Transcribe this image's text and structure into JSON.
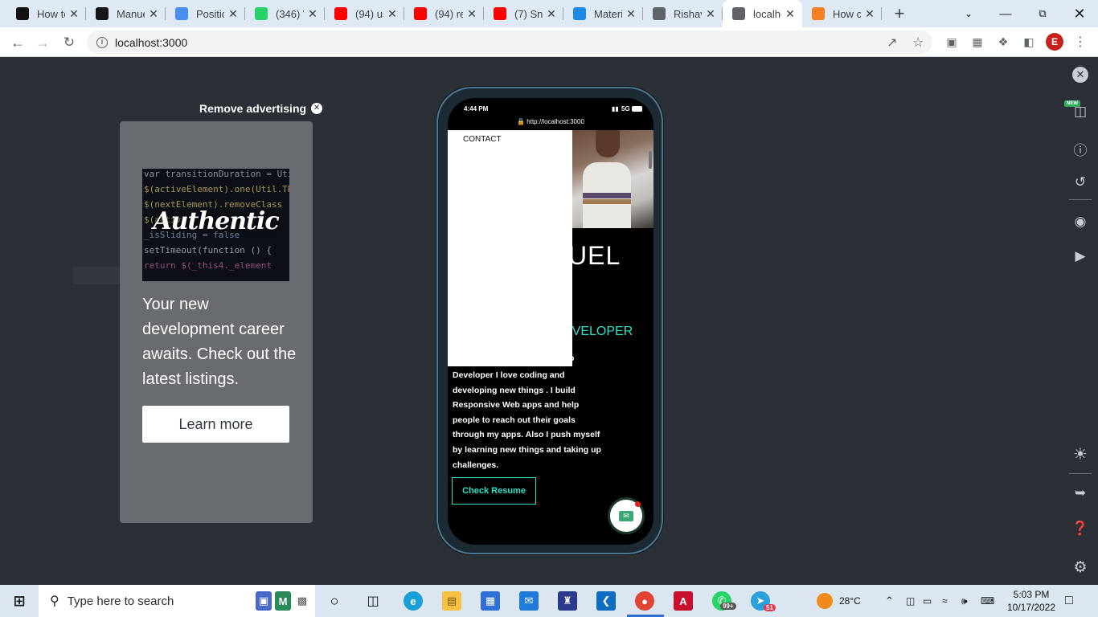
{
  "browser": {
    "tabs": [
      {
        "title": "How to",
        "favicon": "M",
        "color": "#111111"
      },
      {
        "title": "Manue",
        "favicon": "github",
        "color": "#181717"
      },
      {
        "title": "Positic",
        "favicon": "wave",
        "color": "#4a8ef0"
      },
      {
        "title": "(346) W",
        "favicon": "whatsapp",
        "color": "#25d366"
      },
      {
        "title": "(94) us",
        "favicon": "youtube",
        "color": "#ff0000"
      },
      {
        "title": "(94) re",
        "favicon": "youtube",
        "color": "#ff0000"
      },
      {
        "title": "(7) Snc",
        "favicon": "youtube",
        "color": "#ff0000"
      },
      {
        "title": "Materi",
        "favicon": "mui",
        "color": "#1e88e5"
      },
      {
        "title": "Rishav",
        "favicon": "globe",
        "color": "#5f6368"
      },
      {
        "title": "localho",
        "favicon": "globe",
        "color": "#5f6368",
        "active": true
      },
      {
        "title": "How c",
        "favicon": "stack",
        "color": "#f48024"
      }
    ],
    "url": "localhost:3000",
    "profile_initial": "E"
  },
  "ad": {
    "remove_label": "Remove advertising",
    "image_words": "Authentic",
    "code_lines": [
      "var transitionDuration = Util",
      "$(activeElement).one(Util.TR",
      "$(nextElement).removeClass",
      "$(activ",
      "_isSliding = false",
      "setTimeout(function () {",
      "  return $(_this4._element"
    ],
    "headline": "Your new development career awaits. Check out the latest listings.",
    "cta": "Learn more"
  },
  "phone": {
    "time": "4:44 PM",
    "network": "5G",
    "url": "http://localhost:3000",
    "menu_item": "CONTACT",
    "name_fragment": "UEL",
    "role_fragment": "EVELOPER",
    "bio_fragment": "b",
    "bio": "Developer I love coding and developing new things . I build Responsive Web apps and help people to reach out their goals through my apps. Also I push myself by learning new things and taking up challenges.",
    "resume_button": "Check Resume"
  },
  "taskbar": {
    "search_placeholder": "Type here to search",
    "weather": "28°C",
    "time": "5:03 PM",
    "date": "10/17/2022",
    "whatsapp_badge": "99+",
    "telegram_badge": "51"
  }
}
